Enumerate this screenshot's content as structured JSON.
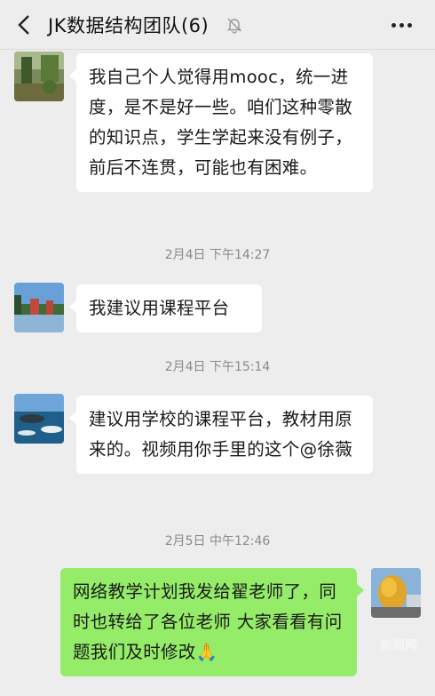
{
  "header": {
    "title": "JK数据结构团队(6)",
    "back_icon": "chevron-left-icon",
    "mute_icon": "bell-off-icon",
    "more_icon": "more-dots-icon"
  },
  "messages": [
    {
      "sender_side": "left",
      "text": "我自己个人觉得用mooc，统一进度，是不是好一些。咱们这种零散的知识点，学生学起来没有例子，前后不连贯，可能也有困难。"
    },
    {
      "sender_side": "left",
      "text": "我建议用课程平台"
    },
    {
      "sender_side": "left",
      "text": "建议用学校的课程平台，教材用原来的。视频用你手里的这个@徐薇"
    },
    {
      "sender_side": "right",
      "text": "网络教学计划我发给翟老师了，同时也转给了各位老师 大家看看有问题我们及时修改🙏"
    }
  ],
  "timestamps": [
    "2月4日 下午14:27",
    "2月4日 下午15:14",
    "2月5日 中午12:46"
  ],
  "watermark": "新闻网",
  "colors": {
    "background": "#ededed",
    "incoming_bubble": "#ffffff",
    "outgoing_bubble": "#95ec69"
  }
}
